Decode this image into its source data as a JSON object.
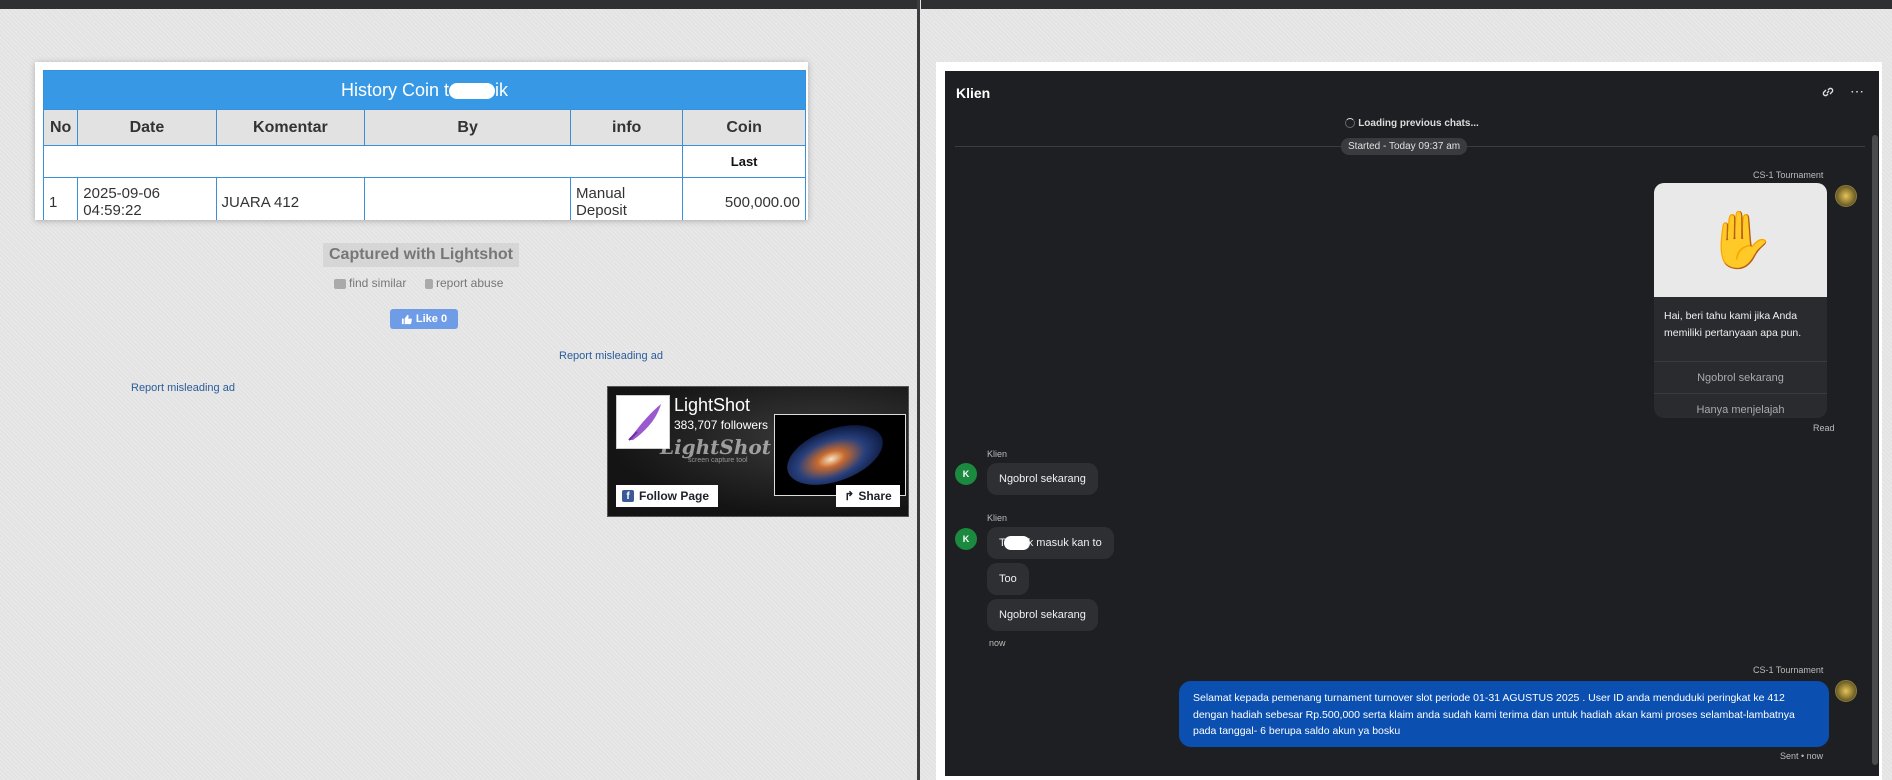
{
  "lightshot": {
    "table": {
      "title_prefix": "History Coin t",
      "title_suffix": "ik",
      "headers": [
        "No",
        "Date",
        "Komentar",
        "By",
        "info",
        "Coin"
      ],
      "last_label": "Last",
      "row": {
        "no": "1",
        "date_line1": "2025-09-06",
        "date_line2": "04:59:22",
        "komentar": "JUARA 412",
        "by": "",
        "info_line1": "Manual",
        "info_line2": "Deposit",
        "coin": "500,000.00"
      }
    },
    "captured_label": "Captured with Lightshot",
    "find_similar": "find similar",
    "report_abuse": "report abuse",
    "like_label": "Like 0",
    "report_misleading_ad": "Report misleading ad",
    "fb": {
      "page_name": "LightShot",
      "followers": "383,707 followers",
      "watermark": "LightShot",
      "watermark_sub": "screen capture tool",
      "follow_label": "Follow Page",
      "share_label": "Share"
    }
  },
  "chat": {
    "title": "Klien",
    "loading": "Loading previous chats...",
    "started": "Started - Today 09:37 am",
    "bot_name": "CS-1 Tournament",
    "welcome_text": "Hai, beri tahu kami jika Anda memiliki pertanyaan apa pun.",
    "welcome_option_1": "Ngobrol sekarang",
    "welcome_option_2": "Hanya menjelajah",
    "read_label": "Read",
    "user_name": "Klien",
    "user_initial": "K",
    "msg1": "Ngobrol sekarang",
    "msg2_prefix": "T",
    "msg2_suffix": "k masuk kan to",
    "msg3": "Too",
    "msg4": "Ngobrol sekarang",
    "now_label": "now",
    "agent_message": "Selamat kepada pemenang turnament turnover slot periode 01-31 AGUSTUS 2025 . User ID anda menduduki peringkat ke 412 dengan hadiah sebesar Rp.500,000 serta klaim anda sudah kami terima dan untuk hadiah akan kami proses selambat-lambatnya pada tanggal- 6 berupa saldo akun ya bosku",
    "sent_label": "Sent • now"
  }
}
